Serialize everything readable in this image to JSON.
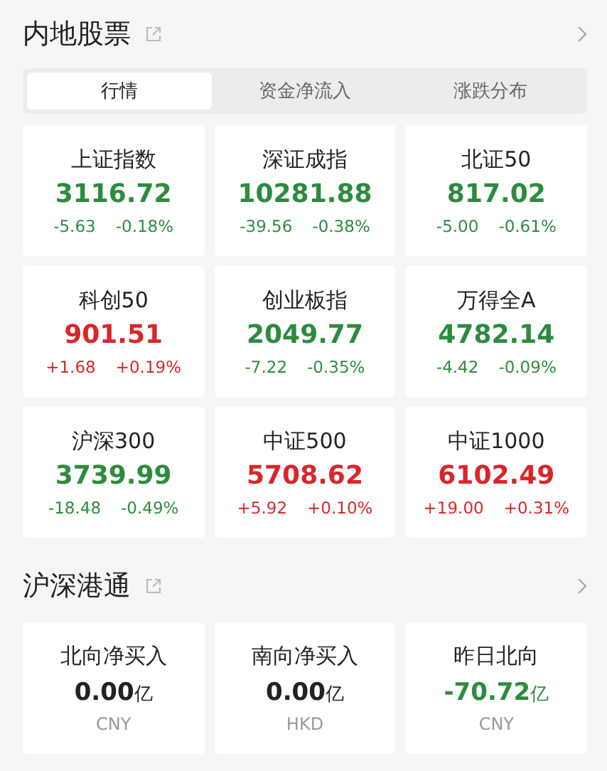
{
  "mainland": {
    "title": "内地股票",
    "tabs": [
      {
        "label": "行情",
        "selected": true
      },
      {
        "label": "资金净流入",
        "selected": false
      },
      {
        "label": "涨跌分布",
        "selected": false
      }
    ],
    "indices": [
      {
        "name": "上证指数",
        "value": "3116.72",
        "change": "-5.63",
        "percent": "-0.18%",
        "color": "#2e8b3e"
      },
      {
        "name": "深证成指",
        "value": "10281.88",
        "change": "-39.56",
        "percent": "-0.38%",
        "color": "#2e8b3e"
      },
      {
        "name": "北证50",
        "value": "817.02",
        "change": "-5.00",
        "percent": "-0.61%",
        "color": "#2e8b3e"
      },
      {
        "name": "科创50",
        "value": "901.51",
        "change": "+1.68",
        "percent": "+0.19%",
        "color": "#d9262c"
      },
      {
        "name": "创业板指",
        "value": "2049.77",
        "change": "-7.22",
        "percent": "-0.35%",
        "color": "#2e8b3e"
      },
      {
        "name": "万得全A",
        "value": "4782.14",
        "change": "-4.42",
        "percent": "-0.09%",
        "color": "#2e8b3e"
      },
      {
        "name": "沪深300",
        "value": "3739.99",
        "change": "-18.48",
        "percent": "-0.49%",
        "color": "#2e8b3e"
      },
      {
        "name": "中证500",
        "value": "5708.62",
        "change": "+5.92",
        "percent": "+0.10%",
        "color": "#d9262c"
      },
      {
        "name": "中证1000",
        "value": "6102.49",
        "change": "+19.00",
        "percent": "+0.31%",
        "color": "#d9262c"
      }
    ]
  },
  "connect": {
    "title": "沪深港通",
    "flows": [
      {
        "name": "北向净买入",
        "value": "0.00",
        "unit": "亿",
        "currency": "CNY",
        "color": "#222222"
      },
      {
        "name": "南向净买入",
        "value": "0.00",
        "unit": "亿",
        "currency": "HKD",
        "color": "#222222"
      },
      {
        "name": "昨日北向",
        "value": "-70.72",
        "unit": "亿",
        "currency": "CNY",
        "color": "#2e8b3e"
      }
    ]
  }
}
